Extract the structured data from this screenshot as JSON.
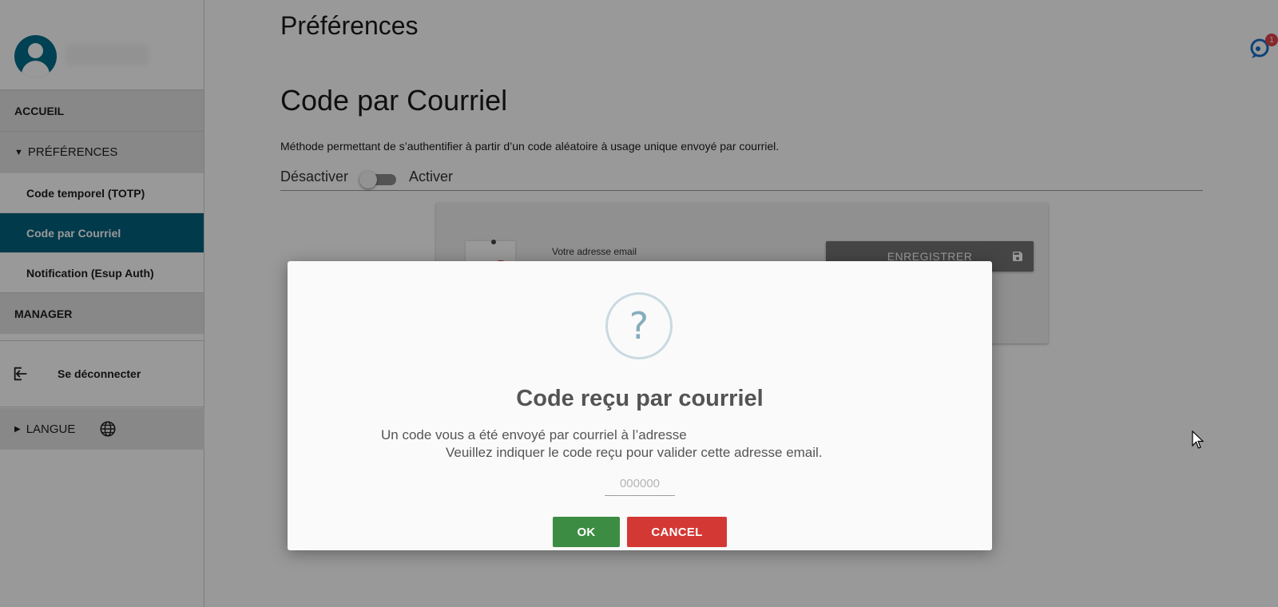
{
  "sidebar": {
    "nav": {
      "accueil": "ACCUEIL",
      "preferences": "PRÉFÉRENCES",
      "items": [
        "Code temporel (TOTP)",
        "Code par Courriel",
        "Notification (Esup Auth)"
      ],
      "manager": "MANAGER"
    },
    "logout": "Se déconnecter",
    "langue": "LANGUE"
  },
  "main": {
    "page_title": "Préférences",
    "section_title": "Code par Courriel",
    "description": "Méthode permettant de s’authentifier à partir d’un code aléatoire à usage unique envoyé par courriel.",
    "toggle": {
      "off_label": "Désactiver",
      "on_label": "Activer",
      "state": "off"
    },
    "card": {
      "email_label": "Votre adresse email",
      "save_button": "ENREGISTRER"
    },
    "chat_badge_count": "1"
  },
  "dialog": {
    "title": "Code reçu par courriel",
    "message_line1": "Un code vous a été envoyé par courriel à l’adresse",
    "message_line2": "Veuillez indiquer le code reçu pour valider cette adresse email.",
    "code_input": {
      "value": "",
      "placeholder": "000000"
    },
    "ok_button": "OK",
    "cancel_button": "CANCEL"
  },
  "colors": {
    "primary": "#00627d",
    "ok": "#3c8c43",
    "cancel": "#d43835"
  }
}
